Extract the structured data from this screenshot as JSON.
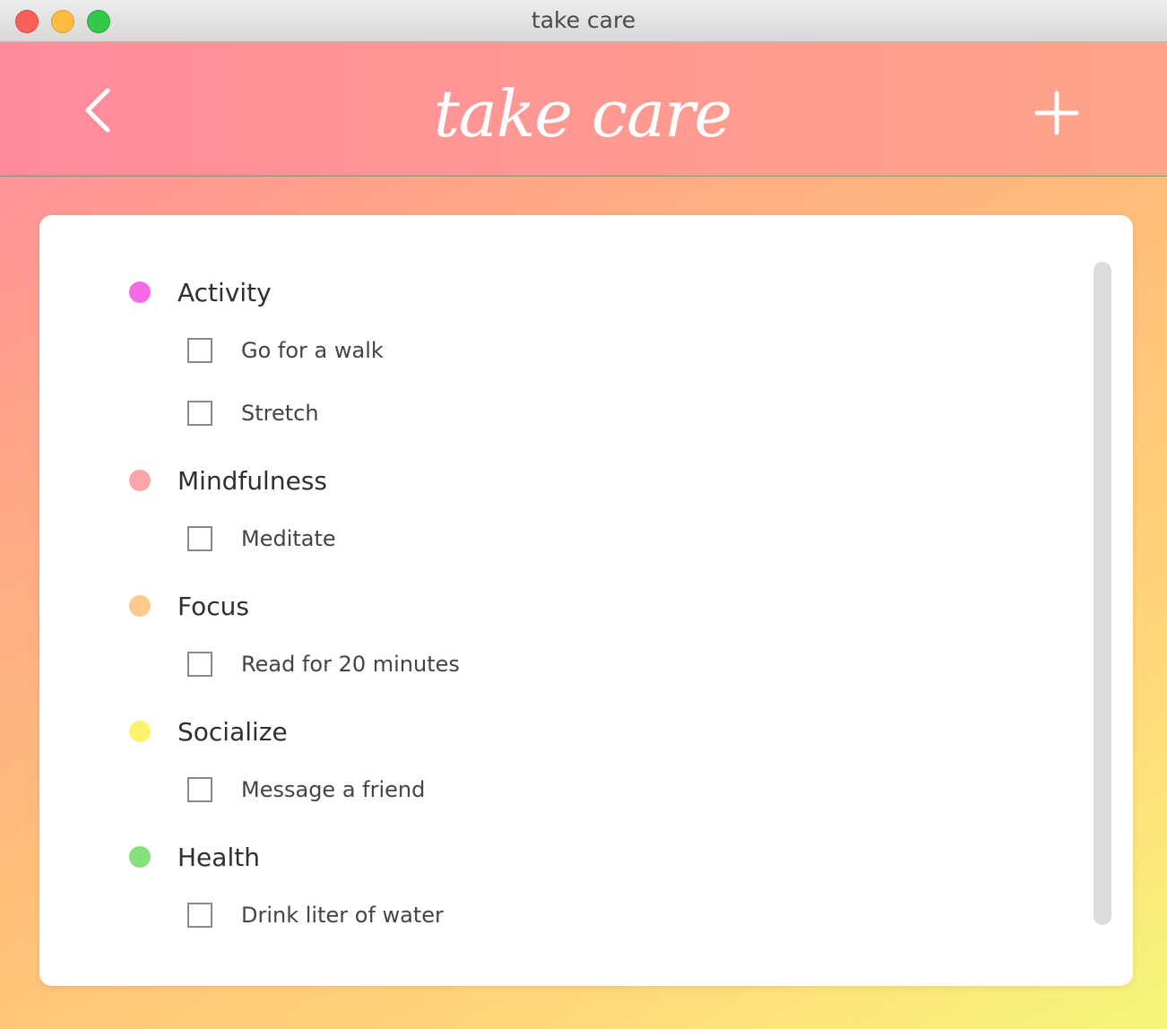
{
  "window": {
    "title": "take care"
  },
  "header": {
    "logo_text": "take care",
    "back_icon": "chevron-left-icon",
    "add_icon": "plus-icon"
  },
  "categories": [
    {
      "label": "Activity",
      "color": "#f56be6",
      "tasks": [
        "Go for a walk",
        "Stretch"
      ]
    },
    {
      "label": "Mindfulness",
      "color": "#fda4a6",
      "tasks": [
        "Meditate"
      ]
    },
    {
      "label": "Focus",
      "color": "#fec98b",
      "tasks": [
        "Read for 20 minutes"
      ]
    },
    {
      "label": "Socialize",
      "color": "#fcf26b",
      "tasks": [
        "Message a friend"
      ]
    },
    {
      "label": "Health",
      "color": "#86e07a",
      "tasks": [
        "Drink liter of water"
      ]
    }
  ]
}
